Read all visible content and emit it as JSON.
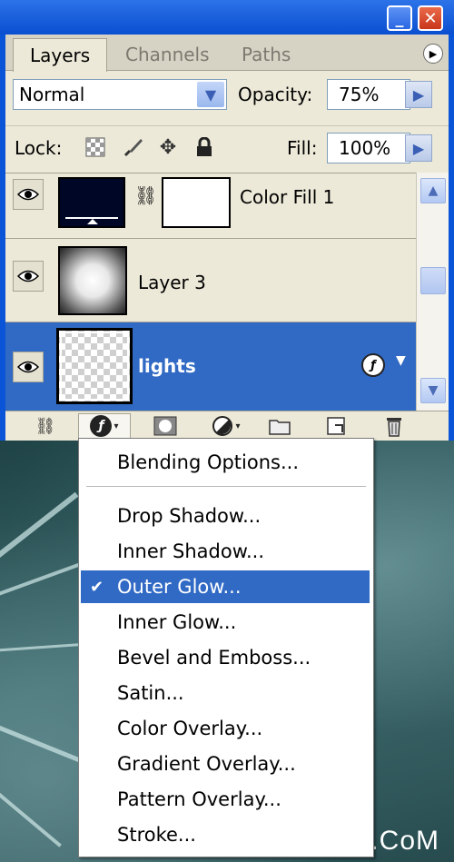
{
  "window": {
    "minimize_glyph": "_",
    "close_glyph": "✕"
  },
  "tabs": [
    {
      "label": "Layers",
      "active": true
    },
    {
      "label": "Channels",
      "active": false
    },
    {
      "label": "Paths",
      "active": false
    }
  ],
  "blend": {
    "mode": "Normal",
    "opacity_label": "Opacity:",
    "opacity_value": "75%"
  },
  "lock": {
    "label": "Lock:",
    "fill_label": "Fill:",
    "fill_value": "100%"
  },
  "layers": [
    {
      "name": "Color Fill 1",
      "type": "fill",
      "visible": true,
      "selected": false
    },
    {
      "name": "Layer 3",
      "type": "gradient",
      "visible": true,
      "selected": false
    },
    {
      "name": "lights",
      "type": "transparent",
      "visible": true,
      "selected": true,
      "has_effects": true
    }
  ],
  "icons": {
    "eye": "eye-icon",
    "link": "link-icon",
    "fx": "layer-style-icon",
    "mask": "mask-icon",
    "adjust": "adjustment-layer-icon",
    "group": "folder-icon",
    "new": "new-layer-icon",
    "trash": "trash-icon"
  },
  "menu": {
    "items": [
      {
        "label": "Blending Options...",
        "checked": false,
        "highlighted": false
      },
      {
        "label": "Drop Shadow...",
        "checked": false,
        "highlighted": false
      },
      {
        "label": "Inner Shadow...",
        "checked": false,
        "highlighted": false
      },
      {
        "label": "Outer Glow...",
        "checked": true,
        "highlighted": true
      },
      {
        "label": "Inner Glow...",
        "checked": false,
        "highlighted": false
      },
      {
        "label": "Bevel and Emboss...",
        "checked": false,
        "highlighted": false
      },
      {
        "label": "Satin...",
        "checked": false,
        "highlighted": false
      },
      {
        "label": "Color Overlay...",
        "checked": false,
        "highlighted": false
      },
      {
        "label": "Gradient Overlay...",
        "checked": false,
        "highlighted": false
      },
      {
        "label": "Pattern Overlay...",
        "checked": false,
        "highlighted": false
      },
      {
        "label": "Stroke...",
        "checked": false,
        "highlighted": false
      }
    ]
  },
  "watermark": "UiBQ.CoM",
  "colors": {
    "selection": "#316ac5",
    "panel": "#ece9d8",
    "titlebar": "#0a54d8"
  }
}
